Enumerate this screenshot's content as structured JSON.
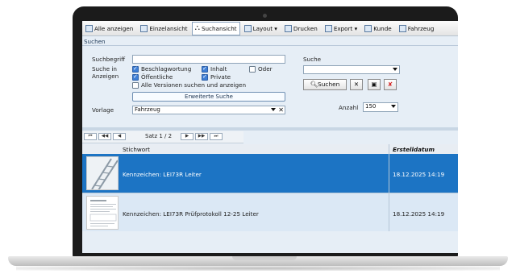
{
  "toolbar": {
    "items": [
      {
        "label": "Alle anzeigen",
        "icon": "list-icon"
      },
      {
        "label": "Einzelansicht",
        "icon": "single-view-icon"
      },
      {
        "label": "Suchansicht",
        "icon": "binoculars-icon"
      },
      {
        "label": "Layout ▾",
        "icon": "layout-icon"
      },
      {
        "label": "Drucken",
        "icon": "printer-icon"
      },
      {
        "label": "Export ▾",
        "icon": "export-icon"
      },
      {
        "label": "Kunde",
        "icon": "customer-icon"
      },
      {
        "label": "Fahrzeug",
        "icon": "vehicle-icon"
      }
    ]
  },
  "search_panel": {
    "title": "Suchen",
    "suchbegriff_label": "Suchbegriff",
    "suchbegriff_value": "",
    "suche_in_label": "Suche in",
    "anzeigen_label": "Anzeigen",
    "checkboxes": {
      "beschlagwortung": {
        "label": "Beschlagwortung",
        "checked": true
      },
      "inhalt": {
        "label": "Inhalt",
        "checked": true
      },
      "oder": {
        "label": "Oder",
        "checked": false
      },
      "oeffentliche": {
        "label": "Öffentliche",
        "checked": true
      },
      "private": {
        "label": "Private",
        "checked": true
      },
      "alle_versionen": {
        "label": "Alle Versionen suchen und anzeigen",
        "checked": false
      }
    },
    "erweiterte_suche": "Erweiterte Suche",
    "vorlage_label": "Vorlage",
    "vorlage_value": "Fahrzeug",
    "suche_label": "Suche",
    "suche_value": "",
    "suchen_button": "Suchen",
    "anzahl_label": "Anzahl",
    "anzahl_value": "150"
  },
  "nav": {
    "buttons": [
      "⏮",
      "◀◀",
      "◀",
      "▶",
      "▶▶",
      "⏭"
    ],
    "satz": "Satz 1 / 2"
  },
  "table": {
    "col_stichwort": "Stichwort",
    "col_datum": "Erstelldatum",
    "rows": [
      {
        "stichwort": "Kennzeichen: LEI73R  Leiter",
        "datum": "18.12.2025 14:19"
      },
      {
        "stichwort": "Kennzeichen: LEI73R  Prüfprotokoll 12-25 Leiter",
        "datum": "18.12.2025 14:19"
      }
    ]
  },
  "colors": {
    "selected_row": "#1c74c4",
    "panel_bg": "#e6eef6",
    "accent": "#3f7fd6"
  }
}
